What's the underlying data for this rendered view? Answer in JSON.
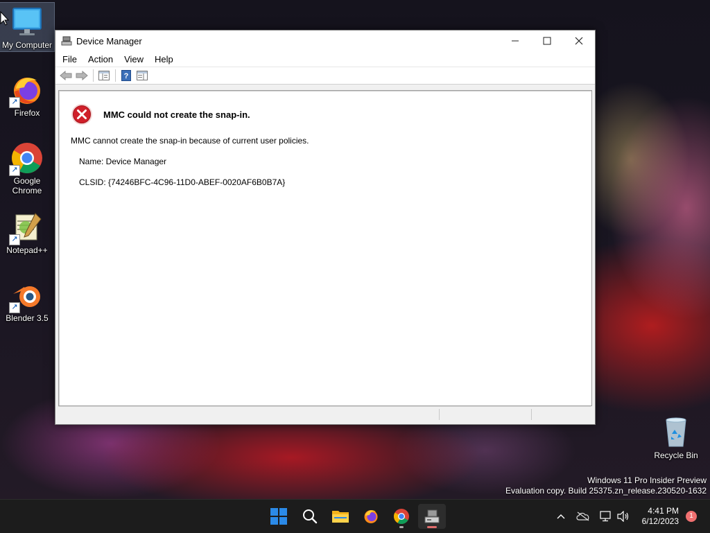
{
  "desktop": {
    "icons": [
      {
        "label": "My Computer"
      },
      {
        "label": "Firefox"
      },
      {
        "label": "Google Chrome"
      },
      {
        "label": "Notepad++"
      },
      {
        "label": "Blender 3.5"
      },
      {
        "label": "Recycle Bin"
      }
    ],
    "watermark": {
      "line1": "Windows 11 Pro Insider Preview",
      "line2": "Evaluation copy. Build 25375.zn_release.230520-1632"
    }
  },
  "window": {
    "title": "Device Manager",
    "menu": [
      "File",
      "Action",
      "View",
      "Help"
    ],
    "error": {
      "title": "MMC could not create the snap-in.",
      "message": "MMC cannot create the snap-in because of current user policies.",
      "name_line": "Name: Device Manager",
      "clsid_line": "CLSID: {74246BFC-4C96-11D0-ABEF-0020AF6B0B7A}"
    }
  },
  "taskbar": {
    "clock_time": "4:41 PM",
    "clock_date": "6/12/2023",
    "notification_count": "1"
  },
  "colors": {
    "error_red": "#d0202a",
    "taskbar_bg": "#1c1c1c",
    "windows_blue": "#2b8ae8"
  }
}
